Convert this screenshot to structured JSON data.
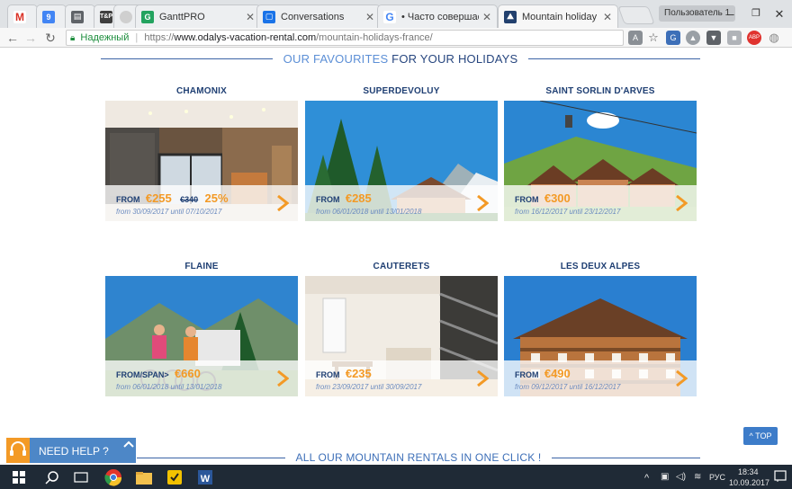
{
  "browser": {
    "tabs": [
      {
        "title": "",
        "favicon": "gmail-icon",
        "favicon_color": "#d93025"
      },
      {
        "title": "",
        "favicon": "calendar-icon",
        "favicon_color": "#4285f4"
      },
      {
        "title": "",
        "favicon": "docs-icon",
        "favicon_color": "#5f6368"
      },
      {
        "title": "",
        "favicon": "tp-icon",
        "favicon_color": "#3f3f3f"
      },
      {
        "title": "",
        "favicon": "blank-icon",
        "favicon_color": "#cfcfcf"
      },
      {
        "title": "GanttPRO",
        "favicon": "ganttpro-icon",
        "favicon_color": "#23a35f"
      },
      {
        "title": "Conversations",
        "favicon": "conversations-icon",
        "favicon_color": "#1a73e8"
      },
      {
        "title": "• Часто совершаемые о",
        "favicon": "google-icon",
        "favicon_color": "#4285f4"
      },
      {
        "title": "Mountain holiday rentals",
        "favicon": "odalys-icon",
        "favicon_color": "#22406e"
      }
    ],
    "profile_label": "Пользователь 1",
    "window_controls": {
      "minimize": "–",
      "restore": "❐",
      "close": "✕"
    }
  },
  "address": {
    "secure_label": "Надежный",
    "url_scheme": "https://",
    "url_host": "www.odalys-vacation-rental.com",
    "url_path": "/mountain-holidays-france/"
  },
  "page": {
    "heading_light": "OUR FAVOURITES ",
    "heading_bold": "FOR YOUR HOLIDAYS",
    "from_label": "FROM",
    "footer_heading": "ALL OUR MOUNTAIN RENTALS IN ONE CLICK !",
    "top_button": "^ TOP",
    "help_label": "NEED HELP ?",
    "cards": [
      {
        "title": "CHAMONIX",
        "from": "FROM",
        "price": "€255",
        "old_price": "€340",
        "discount": "25%",
        "dates": "from 30/09/2017 until 07/10/2017"
      },
      {
        "title": "SUPERDEVOLUY",
        "from": "FROM",
        "price": "€285",
        "old_price": "",
        "discount": "",
        "dates": "from 06/01/2018 until 13/01/2018"
      },
      {
        "title": "SAINT SORLIN D'ARVES",
        "from": "FROM",
        "price": "€300",
        "old_price": "",
        "discount": "",
        "dates": "from 16/12/2017 until 23/12/2017"
      },
      {
        "title": "FLAINE",
        "from": "FROM/SPAN>",
        "price": "€660",
        "old_price": "",
        "discount": "",
        "dates": "from 06/01/2018 until 13/01/2018"
      },
      {
        "title": "CAUTERETS",
        "from": "FROM",
        "price": "€235",
        "old_price": "",
        "discount": "",
        "dates": "from 23/09/2017 until 30/09/2017"
      },
      {
        "title": "LES DEUX ALPES",
        "from": "FROM",
        "price": "€490",
        "old_price": "",
        "discount": "",
        "dates": "from 09/12/2017 until 16/12/2017"
      }
    ]
  },
  "taskbar": {
    "language": "РУС",
    "time": "18:34",
    "date": "10.09.2017"
  },
  "colors": {
    "accent_orange": "#f39a26",
    "navy": "#1f3f73",
    "heading_blue": "#5c8fd6",
    "help_blue": "#4d87c7"
  }
}
